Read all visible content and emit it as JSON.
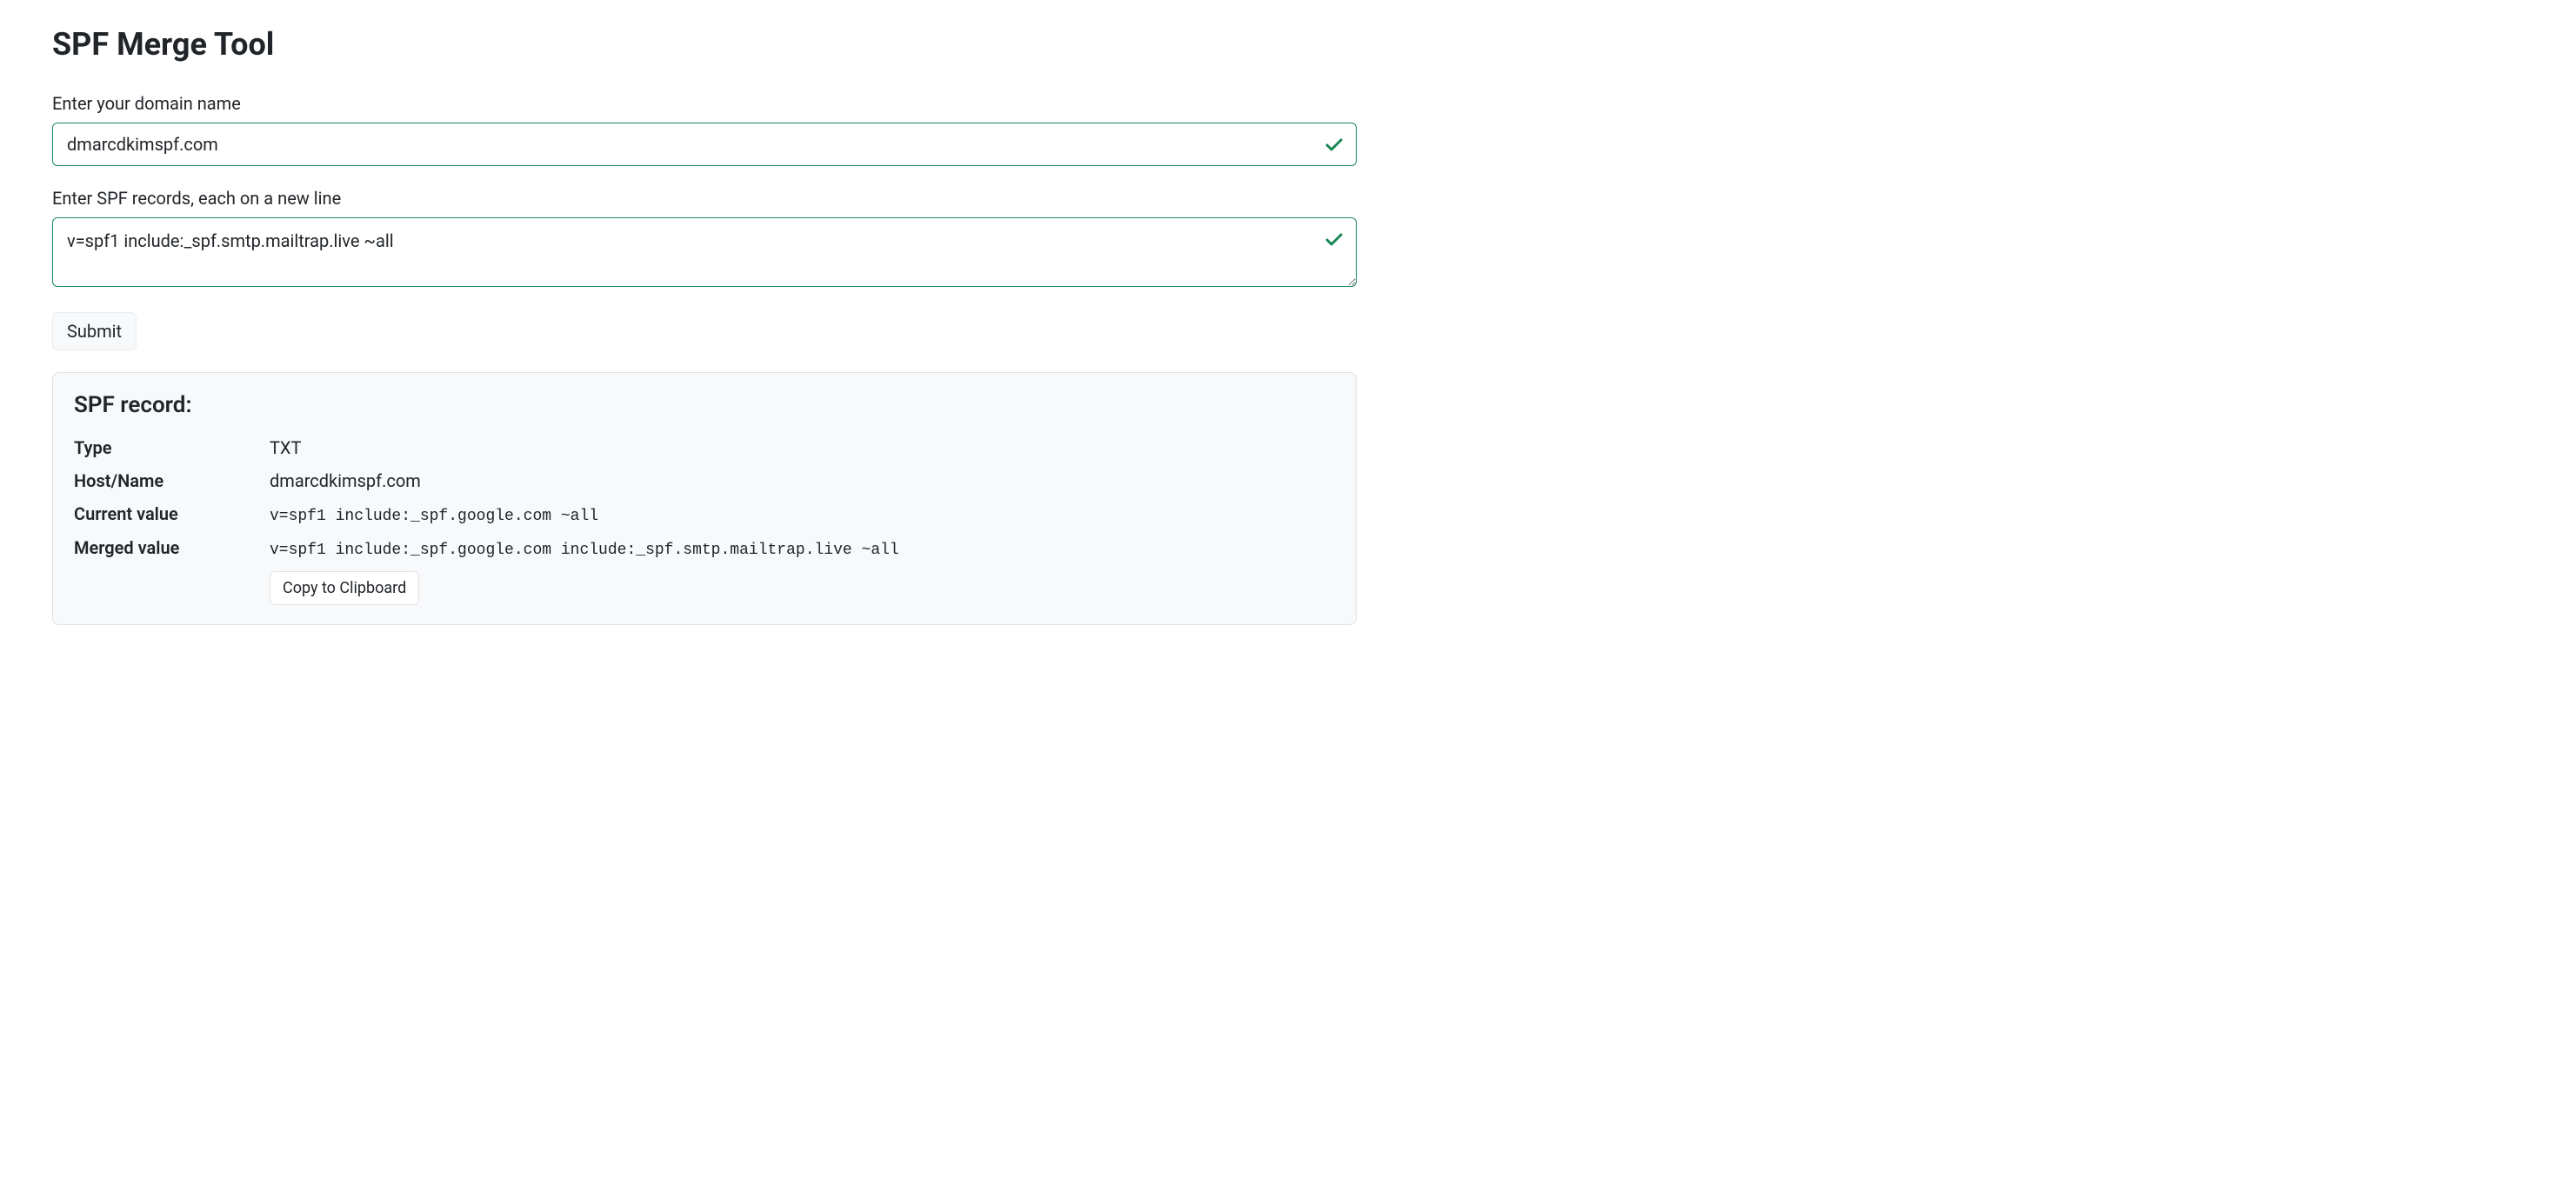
{
  "page": {
    "title": "SPF Merge Tool"
  },
  "form": {
    "domain_label": "Enter your domain name",
    "domain_value": "dmarcdkimspf.com",
    "records_label": "Enter SPF records, each on a new line",
    "records_value": "v=spf1 include:_spf.smtp.mailtrap.live ~all",
    "submit_label": "Submit"
  },
  "result": {
    "heading": "SPF record:",
    "type_label": "Type",
    "type_value": "TXT",
    "host_label": "Host/Name",
    "host_value": "dmarcdkimspf.com",
    "current_label": "Current value",
    "current_value": "v=spf1 include:_spf.google.com ~all",
    "merged_label": "Merged value",
    "merged_value": "v=spf1 include:_spf.google.com include:_spf.smtp.mailtrap.live ~all",
    "copy_label": "Copy to Clipboard"
  }
}
